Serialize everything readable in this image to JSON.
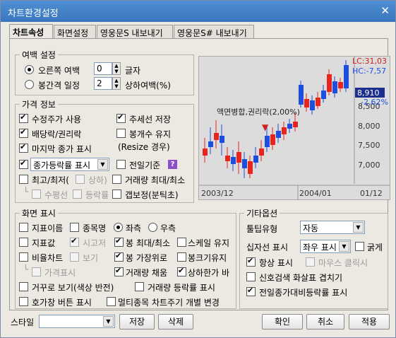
{
  "window": {
    "title": "차트환경설정",
    "close": "✕"
  },
  "tabs": [
    "차트속성",
    "화면설정",
    "영웅문S 내보내기",
    "영웅문S# 내보내기"
  ],
  "margin": {
    "legend": "여백 설정",
    "right_margin_label": "오른쪽 여백",
    "right_margin_value": "0",
    "right_margin_unit": "글자",
    "bar_gap_label": "봉간격 일정",
    "bar_gap_value": "2",
    "bar_gap_unit": "상하여백(%)"
  },
  "price": {
    "legend": "가격 정보",
    "items": {
      "adj_price": "수정주가 사용",
      "trendline": "추세선 저장",
      "dividend": "배당락/권리락",
      "keep_bar": "봉개수 유지",
      "resize": "(Resize 경우)",
      "last_price": "마지막 종가 표시",
      "change_rate_combo": "종가등락률 표시",
      "prev_day": "전일기준",
      "help": "?",
      "hi_lo": "최고/최저(",
      "hi_lo_opt": "상하)",
      "volume_hi_lo": "거래량 최대/최소",
      "flat": "수평선",
      "change_rate": "등락률",
      "gap": "갭보정(분틱초)"
    }
  },
  "screen": {
    "legend": "화면 표시",
    "items": {
      "indicator_name": "지표이름",
      "stock_name": "종목명",
      "left_axis": "좌측",
      "right_axis": "우측",
      "indicator_value": "지표값",
      "time_axis": "시고저",
      "bar_hilo": "봉 최대/최소",
      "scale_keep": "스케일 유지",
      "ratio_chart": "비율차트",
      "view": "보기",
      "bar_top": "봉 가장위로",
      "bar_size": "봉크기유지",
      "price_show": "가격표시",
      "volume_fill": "거래량 채움",
      "up_down_same": "상하한가 바",
      "reverse": "거꾸로 보기(색상 반전)",
      "volume_rate": "거래량 등락률 표시",
      "quote_button": "호가창 버튼 표시",
      "multi_stock": "멀티종목 차트주기 개별 변경"
    }
  },
  "other": {
    "legend": "기타옵션",
    "tooltip_label": "툴팁유형",
    "tooltip_value": "자동",
    "crosshair_label": "십자선 표시",
    "crosshair_value": "좌우 표시",
    "bold": "굵게",
    "always_show": "항상 표시",
    "mouse_click": "마우스 클릭시",
    "signal_arrow": "신호검색 화살표 겹치기",
    "prev_volume_rate": "전일종가대비등락률 표시"
  },
  "chart_preview": {
    "lc": "LC:31,03",
    "hc": "HC:-7,57",
    "price_box": "8,910",
    "pct": "-2,62%",
    "y_ticks": [
      "8,500",
      "8,000",
      "7,500",
      "7,000"
    ],
    "annotation": "액면병합,권리락(2,00%)",
    "x_labels": [
      "2003/12",
      "2004/01",
      "01/12"
    ],
    "colors": {
      "up": "#e8251c",
      "down": "#1c4fe0",
      "bg": "#dcdcdc"
    }
  },
  "footer": {
    "style_label": "스타일",
    "save": "저장",
    "delete": "삭제",
    "ok": "확인",
    "cancel": "취소",
    "apply": "적용"
  }
}
